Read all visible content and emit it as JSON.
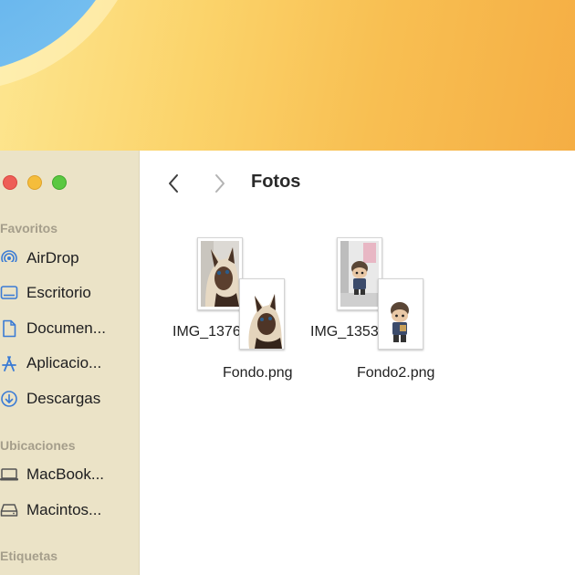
{
  "window": {
    "title": "Fotos"
  },
  "toolbar": {
    "back_icon": "chevron-left-icon",
    "forward_icon": "chevron-right-icon"
  },
  "sidebar": {
    "favorites_header": "Favoritos",
    "favorites": [
      {
        "label": "AirDrop",
        "icon": "airdrop-icon"
      },
      {
        "label": "Escritorio",
        "icon": "desktop-icon"
      },
      {
        "label": "Documen...",
        "icon": "document-icon"
      },
      {
        "label": "Aplicacio...",
        "icon": "applications-icon"
      },
      {
        "label": "Descargas",
        "icon": "downloads-icon"
      }
    ],
    "locations_header": "Ubicaciones",
    "locations": [
      {
        "label": "MacBook...",
        "icon": "laptop-icon"
      },
      {
        "label": "Macintos...",
        "icon": "disk-icon"
      }
    ],
    "tags_header": "Etiquetas"
  },
  "files": [
    {
      "name": "IMG_1376.jpg",
      "thumbnail": "siamese-cat-photo"
    },
    {
      "name": "Fondo.png",
      "thumbnail": "siamese-cat-photo"
    },
    {
      "name": "IMG_1353.jpg",
      "thumbnail": "figurine-photo"
    },
    {
      "name": "Fondo2.png",
      "thumbnail": "figurine-photo"
    }
  ],
  "colors": {
    "sidebar_bg": "#ebe3c7",
    "accent": "#3a7bd5",
    "close": "#ee5e57",
    "minimize": "#f5bd3b",
    "maximize": "#5ac840"
  }
}
